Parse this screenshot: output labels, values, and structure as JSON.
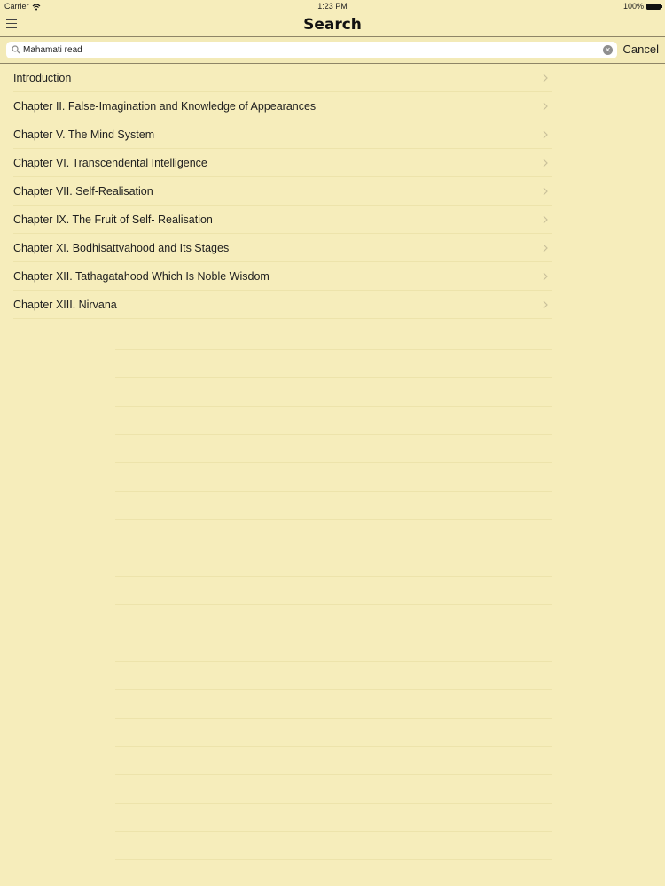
{
  "status_bar": {
    "carrier": "Carrier",
    "time": "1:23 PM",
    "battery": "100%"
  },
  "nav_bar": {
    "title": "Search"
  },
  "search": {
    "query": "Mahamati read",
    "cancel_label": "Cancel"
  },
  "results": [
    {
      "label": "Introduction"
    },
    {
      "label": "Chapter II. False-Imagination and Knowledge of Appearances"
    },
    {
      "label": "Chapter V. The Mind System"
    },
    {
      "label": "Chapter VI. Transcendental Intelligence"
    },
    {
      "label": "Chapter VII. Self-Realisation"
    },
    {
      "label": "Chapter IX. The Fruit of Self- Realisation"
    },
    {
      "label": "Chapter XI. Bodhisattvahood and Its Stages"
    },
    {
      "label": "Chapter XII. Tathagatahood Which Is Noble Wisdom"
    },
    {
      "label": "Chapter XIII. Nirvana"
    }
  ],
  "icons": {
    "menu": "hamburger-menu-icon",
    "wifi": "wifi-icon",
    "battery": "battery-icon",
    "search": "search-icon",
    "clear": "clear-icon",
    "chevron": "chevron-right-icon"
  },
  "colors": {
    "background": "#f6edbb",
    "separator": "#ede3ab",
    "border": "#8e8566",
    "chevron": "#c9c09a"
  }
}
